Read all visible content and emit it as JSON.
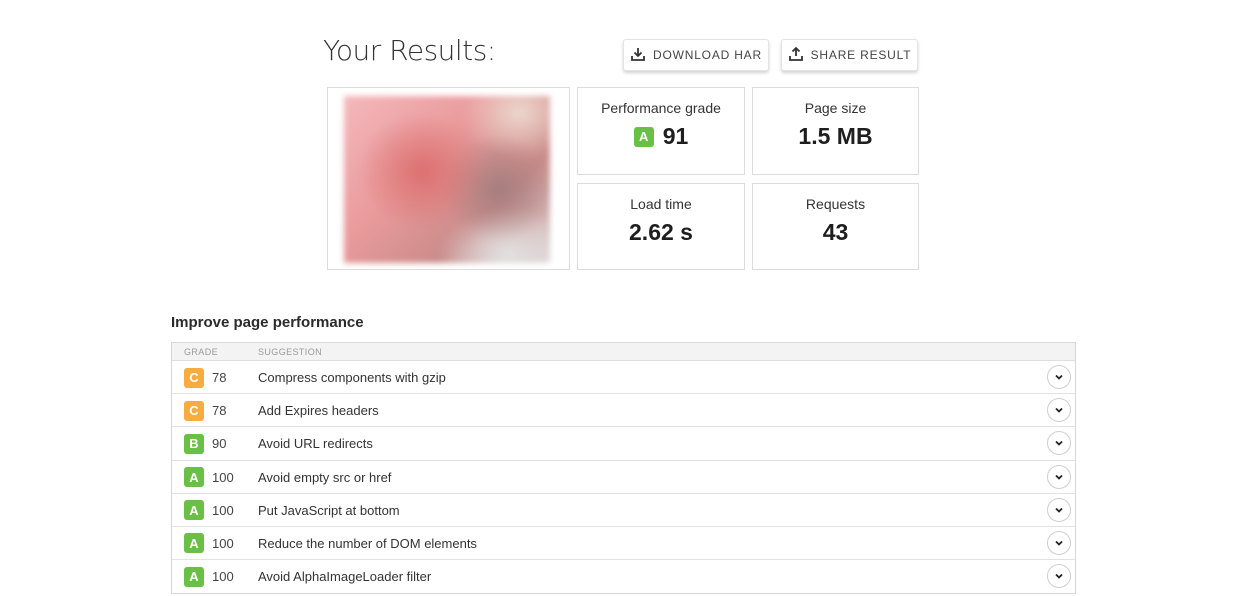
{
  "header": {
    "title": "Your Results:",
    "download_label": "DOWNLOAD HAR",
    "share_label": "SHARE RESULT"
  },
  "metrics": {
    "performance": {
      "label": "Performance grade",
      "grade": "A",
      "value": "91",
      "color": "#6ac045"
    },
    "page_size": {
      "label": "Page size",
      "value": "1.5 MB"
    },
    "load_time": {
      "label": "Load time",
      "value": "2.62 s"
    },
    "requests": {
      "label": "Requests",
      "value": "43"
    }
  },
  "improve": {
    "title": "Improve page performance",
    "columns": {
      "grade": "GRADE",
      "suggestion": "SUGGESTION"
    },
    "rows": [
      {
        "grade": "C",
        "score": "78",
        "suggestion": "Compress components with gzip",
        "color": "#f6ac3e"
      },
      {
        "grade": "C",
        "score": "78",
        "suggestion": "Add Expires headers",
        "color": "#f6ac3e"
      },
      {
        "grade": "B",
        "score": "90",
        "suggestion": "Avoid URL redirects",
        "color": "#6ac045"
      },
      {
        "grade": "A",
        "score": "100",
        "suggestion": "Avoid empty src or href",
        "color": "#6ac045"
      },
      {
        "grade": "A",
        "score": "100",
        "suggestion": "Put JavaScript at bottom",
        "color": "#6ac045"
      },
      {
        "grade": "A",
        "score": "100",
        "suggestion": "Reduce the number of DOM elements",
        "color": "#6ac045"
      },
      {
        "grade": "A",
        "score": "100",
        "suggestion": "Avoid AlphaImageLoader filter",
        "color": "#6ac045"
      }
    ]
  },
  "icons": {
    "download": "download-icon",
    "share": "share-icon",
    "expand": "chevron-down-icon"
  }
}
